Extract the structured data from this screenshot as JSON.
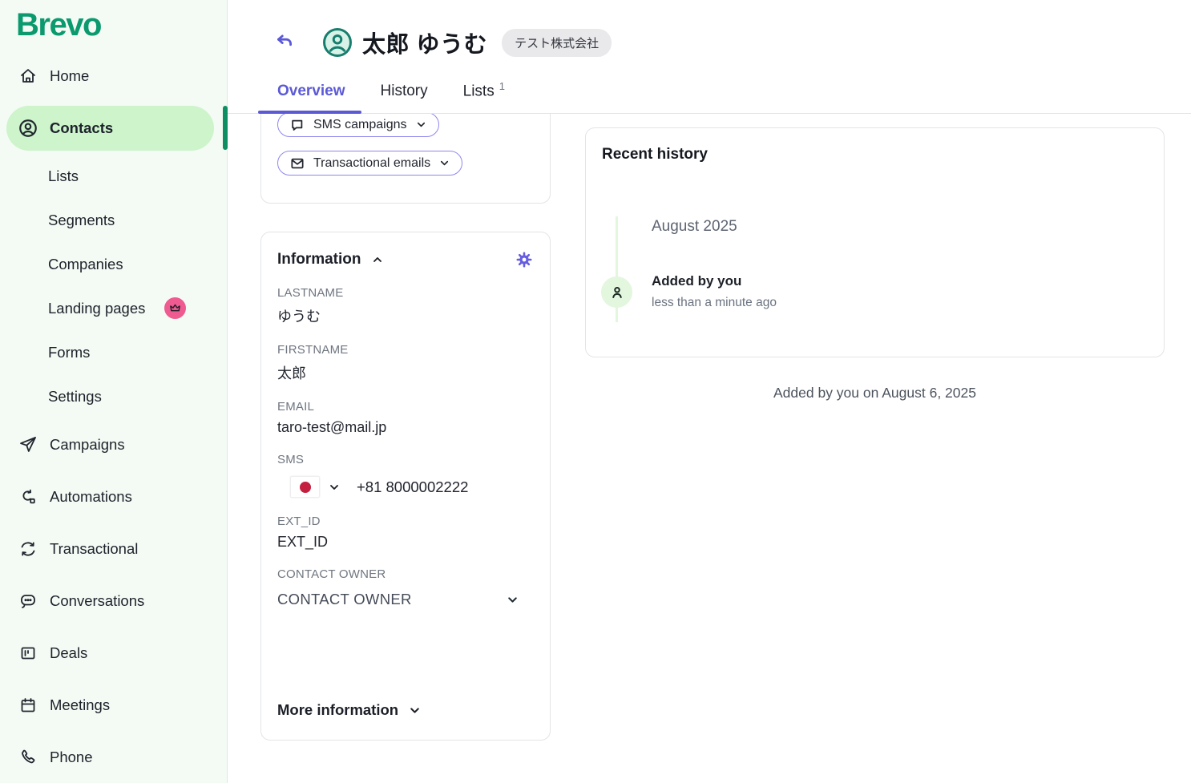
{
  "brand": {
    "name": "Brevo"
  },
  "sidebar": {
    "items": [
      {
        "label": "Home"
      },
      {
        "label": "Contacts"
      },
      {
        "label": "Lists"
      },
      {
        "label": "Segments"
      },
      {
        "label": "Companies"
      },
      {
        "label": "Landing pages"
      },
      {
        "label": "Forms"
      },
      {
        "label": "Settings"
      },
      {
        "label": "Campaigns"
      },
      {
        "label": "Automations"
      },
      {
        "label": "Transactional"
      },
      {
        "label": "Conversations"
      },
      {
        "label": "Deals"
      },
      {
        "label": "Meetings"
      },
      {
        "label": "Phone"
      }
    ]
  },
  "header": {
    "contact_name": "太郎 ゆうむ",
    "company_badge": "テスト株式会社"
  },
  "tabs": {
    "overview": "Overview",
    "history": "History",
    "lists": "Lists",
    "lists_count": "1"
  },
  "engagement": {
    "sms_campaigns_label": "SMS campaigns",
    "transactional_emails_label": "Transactional emails"
  },
  "information": {
    "title": "Information",
    "fields": [
      {
        "label": "LASTNAME",
        "value": "ゆうむ"
      },
      {
        "label": "FIRSTNAME",
        "value": "太郎"
      },
      {
        "label": "EMAIL",
        "value": "taro-test@mail.jp"
      },
      {
        "label": "SMS",
        "value": "+81 8000002222"
      },
      {
        "label": "EXT_ID",
        "value": "EXT_ID"
      },
      {
        "label": "CONTACT OWNER",
        "value": "CONTACT OWNER"
      }
    ],
    "sms_country": "japan-flag",
    "more_label": "More information"
  },
  "history_panel": {
    "title": "Recent history",
    "month": "August 2025",
    "event_title": "Added by you",
    "event_time": "less than a minute ago",
    "footer": "Added by you on August 6, 2025"
  },
  "colors": {
    "brand_green": "#0b996e",
    "sidebar_bg": "#f4fbf4",
    "active_item_bg": "#cdf4cb",
    "active_bar_green": "#0c8f63",
    "accent_purple": "#5b59d6",
    "gear_purple": "#665ee0",
    "pill_border_purple": "#8f87ef",
    "badge_pink": "#ef5a90",
    "flag_red": "#c41f3e",
    "timeline_green": "#e3f6de"
  }
}
